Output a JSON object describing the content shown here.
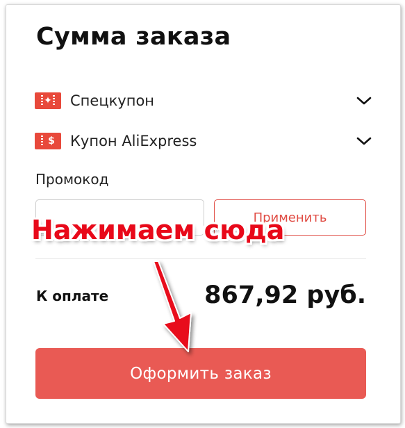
{
  "order_summary": {
    "title": "Сумма заказа",
    "coupons": [
      {
        "label": "Спецкупон",
        "icon": "sparkle-coupon-icon"
      },
      {
        "label": "Купон AliExpress",
        "icon": "dollar-coupon-icon",
        "glyph": "$"
      }
    ],
    "promo": {
      "label": "Промокод",
      "value": "",
      "placeholder": "",
      "apply_label": "Применить"
    },
    "total": {
      "label": "К оплате",
      "value": "867,92 руб."
    },
    "order_button_label": "Оформить заказ"
  },
  "annotation": {
    "text": "Нажимаем сюда"
  },
  "colors": {
    "accent": "#e95a54",
    "coupon_icon": "#e8493b",
    "annotation": "#e8091a"
  }
}
